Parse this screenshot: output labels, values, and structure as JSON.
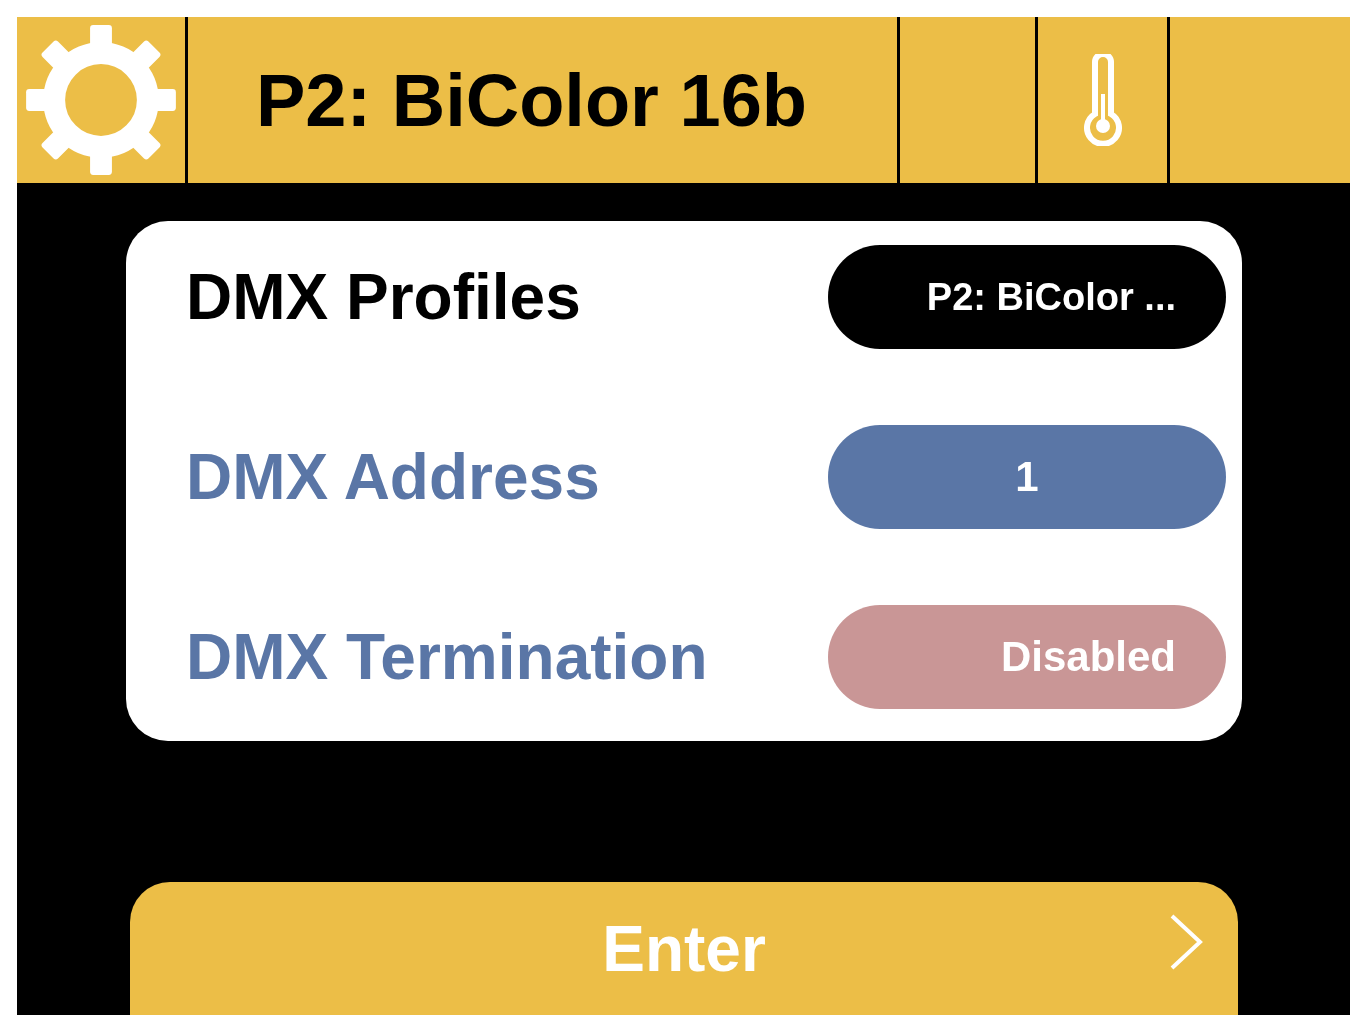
{
  "header": {
    "title": "P2: BiColor 16b"
  },
  "settings": [
    {
      "label": "DMX Profiles",
      "value": "P2: BiColor ...",
      "kind": "select",
      "selected": true
    },
    {
      "label": "DMX Address",
      "value": "1",
      "kind": "number",
      "selected": false,
      "color": "#5a76a6"
    },
    {
      "label": "DMX Termination",
      "value": "Disabled",
      "kind": "toggle",
      "selected": false,
      "color": "#c99696"
    }
  ],
  "enter_button": {
    "label": "Enter"
  }
}
